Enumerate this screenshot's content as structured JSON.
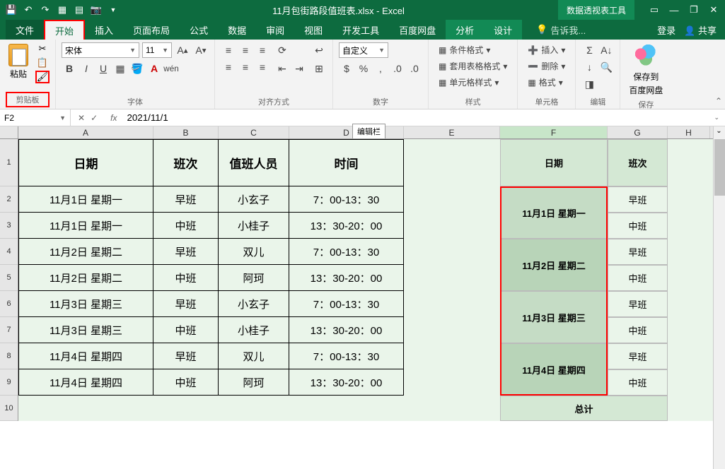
{
  "title": "11月包街路段值班表.xlsx - Excel",
  "pivot_tool": "数据透视表工具",
  "titlebar_icons": [
    "save-icon",
    "undo-icon",
    "redo-icon",
    "touch-icon",
    "print-icon",
    "camera-icon"
  ],
  "window_controls": [
    "ribbon-options-icon",
    "minimize-icon",
    "restore-icon",
    "close-icon"
  ],
  "menus": {
    "file": "文件",
    "home": "开始",
    "insert": "插入",
    "layout": "页面布局",
    "formula": "公式",
    "data": "数据",
    "review": "审阅",
    "view": "视图",
    "dev": "开发工具",
    "baidu": "百度网盘",
    "analyze": "分析",
    "design": "设计"
  },
  "tell_me": "告诉我...",
  "login": "登录",
  "share": "共享",
  "ribbon": {
    "clipboard": {
      "paste": "粘贴",
      "label": "剪贴板"
    },
    "font": {
      "name": "宋体",
      "size": "11",
      "label": "字体"
    },
    "align": {
      "label": "对齐方式"
    },
    "number": {
      "format": "自定义",
      "label": "数字"
    },
    "styles": {
      "cond": "条件格式",
      "table": "套用表格格式",
      "cell": "单元格样式",
      "label": "样式"
    },
    "cells": {
      "insert": "插入",
      "delete": "删除",
      "format": "格式",
      "label": "单元格"
    },
    "edit": {
      "label": "编辑"
    },
    "save": {
      "btn": "保存到",
      "btn2": "百度网盘",
      "label": "保存"
    }
  },
  "namebox": "F2",
  "formula": "2021/11/1",
  "tooltip": "编辑栏",
  "cols": [
    "A",
    "B",
    "C",
    "D",
    "E",
    "F",
    "G",
    "H"
  ],
  "rows": [
    "1",
    "2",
    "3",
    "4",
    "5",
    "6",
    "7",
    "8",
    "9",
    "10"
  ],
  "table": {
    "headers": {
      "date": "日期",
      "shift": "班次",
      "staff": "值班人员",
      "time": "时间"
    },
    "rows": [
      {
        "date": "11月1日 星期一",
        "shift": "早班",
        "staff": "小玄子",
        "time": "7：00-13：30"
      },
      {
        "date": "11月1日 星期一",
        "shift": "中班",
        "staff": "小桂子",
        "time": "13：30-20：00"
      },
      {
        "date": "11月2日 星期二",
        "shift": "早班",
        "staff": "双儿",
        "time": "7：00-13：30"
      },
      {
        "date": "11月2日 星期二",
        "shift": "中班",
        "staff": "阿珂",
        "time": "13：30-20：00"
      },
      {
        "date": "11月3日 星期三",
        "shift": "早班",
        "staff": "小玄子",
        "time": "7：00-13：30"
      },
      {
        "date": "11月3日 星期三",
        "shift": "中班",
        "staff": "小桂子",
        "time": "13：30-20：00"
      },
      {
        "date": "11月4日 星期四",
        "shift": "早班",
        "staff": "双儿",
        "time": "7：00-13：30"
      },
      {
        "date": "11月4日 星期四",
        "shift": "中班",
        "staff": "阿珂",
        "time": "13：30-20：00"
      }
    ]
  },
  "pivot": {
    "date_hdr": "日期",
    "shift_hdr": "班次",
    "dates": [
      "11月1日 星期一",
      "11月2日 星期二",
      "11月3日 星期三",
      "11月4日 星期四"
    ],
    "shifts": [
      "早班",
      "中班",
      "早班",
      "中班",
      "早班",
      "中班",
      "早班",
      "中班"
    ],
    "total": "总计"
  }
}
